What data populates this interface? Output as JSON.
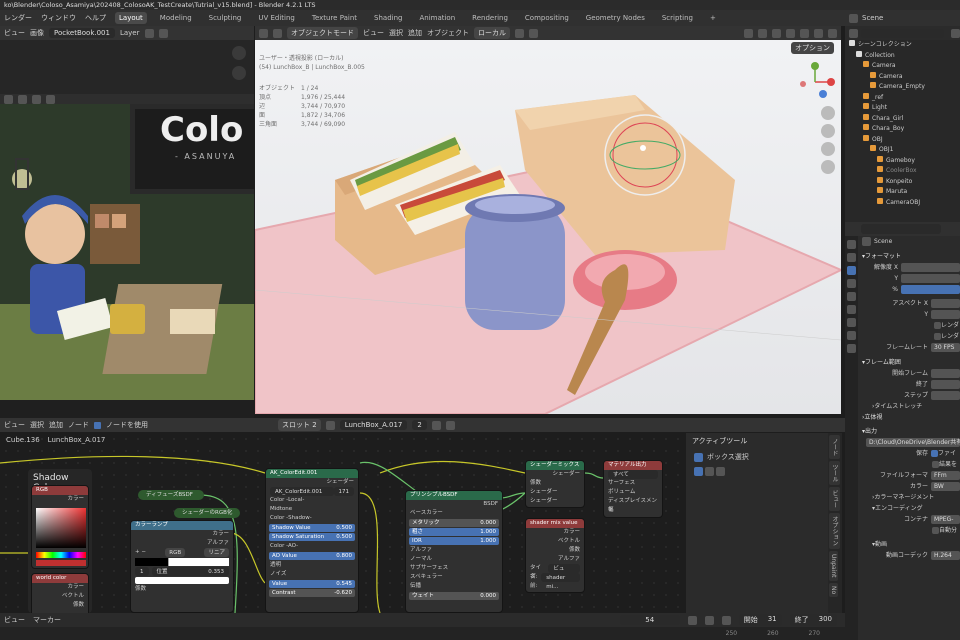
{
  "title": "ko\\Blender\\Coloso_Asamiya\\202408_ColosoAK_TestCreate\\Tutrial_v15.blend] - Blender 4.2.1 LTS",
  "menu": [
    "レンダー",
    "ウィンドウ",
    "ヘルプ"
  ],
  "workspaces": [
    "Layout",
    "Modeling",
    "Sculpting",
    "UV Editing",
    "Texture Paint",
    "Shading",
    "Animation",
    "Rendering",
    "Compositing",
    "Geometry Nodes",
    "Scripting",
    "+"
  ],
  "active_workspace": "Layout",
  "image_editor": {
    "menu": [
      "ビュー",
      "画像"
    ],
    "image_name": "PocketBook.001",
    "layer": "Layer",
    "poster_text": "Colo",
    "poster_sub": "- ASANUYA"
  },
  "viewport": {
    "header": {
      "mode": "オブジェクトモード",
      "menus": [
        "ビュー",
        "選択",
        "追加",
        "オブジェクト"
      ],
      "orientation": "ローカル",
      "options": "オプション"
    },
    "info": {
      "line1": "ユーザー・透視投影 (ローカル)",
      "line2": "(54) LunchBox_B | LunchBox_B.005",
      "rows": [
        [
          "オブジェクト",
          "1 / 24"
        ],
        [
          "頂点",
          "1,976 / 25,444"
        ],
        [
          "辺",
          "3,744 / 70,970"
        ],
        [
          "面",
          "1,872 / 34,706"
        ],
        [
          "三角面",
          "3,744 / 69,090"
        ]
      ]
    }
  },
  "node_editor": {
    "menus": [
      "ビュー",
      "選択",
      "追加",
      "ノード"
    ],
    "use_nodes": "ノードを使用",
    "slot": "スロット 2",
    "material": "LunchBox_A.017",
    "users": "2",
    "breadcrumb": [
      "Cube.136",
      "LunchBox_A.017"
    ],
    "frame_title": "Shadow Color",
    "nodes": {
      "rgb": {
        "title": "RGB",
        "out": "カラー"
      },
      "world": {
        "title": "world color",
        "rows": [
          "カラー",
          "ベクトル",
          "係数"
        ]
      },
      "difuse": {
        "title": "ディフューズBSDF"
      },
      "shader_rgb": {
        "title": "シェーダーのRGB化"
      },
      "ramp": {
        "title": "カラーランプ",
        "rows": [
          "カラー",
          "アルファ"
        ],
        "mode": "RGB",
        "interp": "リニア",
        "index": "1",
        "pos_label": "位置",
        "pos": "0.353",
        "factor": "係数"
      },
      "ak": {
        "title": "AK_ColorEdit.001",
        "group": "AK_ColorEdit.001",
        "users": "171",
        "shader": "シェーダー",
        "rows": [
          "Color -Local-",
          "Midtone",
          "Color -Shadow-"
        ],
        "sliders": [
          [
            "Shadow Value",
            "0.500"
          ],
          [
            "Shadow Saturation",
            "0.500"
          ]
        ],
        "rows2": [
          "Color -AO-"
        ],
        "ao": [
          "AO Value",
          "0.800"
        ],
        "rows3": [
          "透明",
          "ノイズ"
        ],
        "sliders2": [
          [
            "Value",
            "0.545"
          ],
          [
            "Contrast",
            "-0.620"
          ]
        ]
      },
      "principled": {
        "title": "プリンシプルBSDF",
        "out": "BSDF",
        "rows": [
          "ベースカラー"
        ],
        "sliders": [
          [
            "メタリック",
            "0.000"
          ],
          [
            "粗さ",
            "1.000"
          ],
          [
            "IOR",
            "1.000"
          ]
        ],
        "rows2": [
          "アルファ",
          "ノーマル",
          "サブサーフェス",
          "スペキュラー",
          "伝播"
        ],
        "weight": [
          "ウェイト",
          "0.000"
        ]
      },
      "mix": {
        "title": "シェーダーミックス",
        "out": "シェーダー",
        "rows": [
          "係数",
          "シェーダー",
          "シェーダー"
        ]
      },
      "output": {
        "title": "マテリアル出力",
        "target": "すべて",
        "rows": [
          "サーフェス",
          "ボリューム",
          "ディスプレイスメント",
          "幅"
        ]
      },
      "mixval": {
        "title": "shader mix value",
        "rows": [
          "カラー",
          "ベクトル",
          "係数",
          "アルファ"
        ],
        "type_label": "タイプ:",
        "type": "ビュー...",
        "name_label": "名前:",
        "name": "shader mi..."
      }
    },
    "tool_panel": {
      "title": "アクティブツール",
      "tool": "ボックス選択"
    },
    "tabs": [
      "ノード",
      "ツール",
      "ビュー",
      "オプション",
      "Unpaint",
      "No"
    ]
  },
  "timeline": {
    "menus": [
      "ビュー",
      "マーカー"
    ],
    "frame": "54",
    "start_label": "開始",
    "start": "31",
    "end_label": "終了",
    "end": "300",
    "ticks": [
      "250",
      "260",
      "270"
    ]
  },
  "outliner": {
    "title": "Scene",
    "items": [
      {
        "label": "シーンコレクション",
        "depth": 0
      },
      {
        "label": "Collection",
        "depth": 1
      },
      {
        "label": "Camera",
        "depth": 2
      },
      {
        "label": "Camera",
        "depth": 3
      },
      {
        "label": "Camera_Empty",
        "depth": 3
      },
      {
        "label": "_ref",
        "depth": 2
      },
      {
        "label": "Light",
        "depth": 2
      },
      {
        "label": "Chara_Girl",
        "depth": 2
      },
      {
        "label": "Chara_Boy",
        "depth": 2
      },
      {
        "label": "OBJ",
        "depth": 2
      },
      {
        "label": "OBJ1",
        "depth": 3
      },
      {
        "label": "Gameboy",
        "depth": 4
      },
      {
        "label": "CoolerBox",
        "depth": 4
      },
      {
        "label": "Konpeito",
        "depth": 4
      },
      {
        "label": "Maruta",
        "depth": 4
      },
      {
        "label": "CameraOBJ",
        "depth": 4
      }
    ]
  },
  "properties": {
    "scene": "Scene",
    "format_title": "フォーマット",
    "res": [
      "解像度 X",
      "Y",
      "%"
    ],
    "aspect": [
      "アスペクト X",
      "Y"
    ],
    "render": "レンダ",
    "render2": "レンダ",
    "fps_label": "フレームレート",
    "fps": "30 FPS",
    "range_title": "フレーム範囲",
    "range": [
      "開始フレーム",
      "終了",
      "ステップ"
    ],
    "stretch": "タイムストレッチ",
    "stereo": "立体視",
    "output_title": "出力",
    "path": "D:\\Cloud\\OneDrive\\Blender共有",
    "save": "保存",
    "save_val": "ファイ",
    "result": "結果を",
    "file_format": "ファイルフォーマ",
    "file_val": "FFm",
    "color": "カラー",
    "color_val": "BW",
    "color_mgmt": "カラーマネージメント",
    "encoding": "エンコーディング",
    "container": "コンテナ",
    "container_val": "MPEG-",
    "auto": "自動分",
    "video": "動画",
    "codec": "動画コーデック",
    "codec_val": "H.264"
  }
}
